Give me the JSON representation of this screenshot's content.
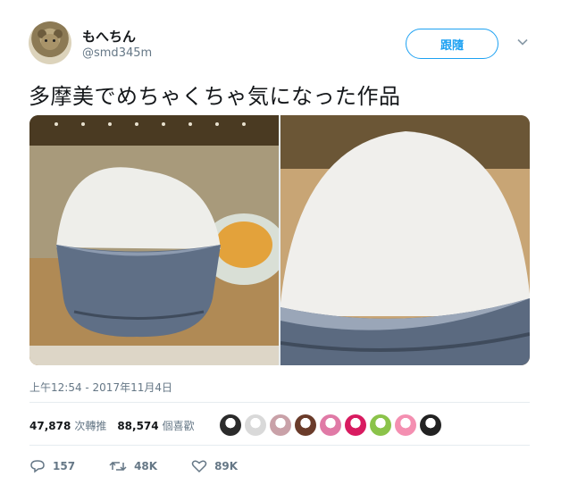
{
  "user": {
    "name": "もへちん",
    "handle": "@smd345m"
  },
  "follow_label": "跟隨",
  "tweet_text": "多摩美でめちゃくちゃ気になった作品",
  "timestamp": "上午12:54 - 2017年11月4日",
  "stats": {
    "retweets_count": "47,878",
    "retweets_label": "次轉推",
    "likes_count": "88,574",
    "likes_label": "個喜歡"
  },
  "likers": [
    "#2b2b2b",
    "#d9d9d9",
    "#c9a1a8",
    "#6a3b2a",
    "#e07aa6",
    "#d81b60",
    "#8bc34a",
    "#f48fb1",
    "#222222"
  ],
  "actions": {
    "replies": "157",
    "retweets": "48K",
    "likes": "89K"
  },
  "colors": {
    "accent": "#1da1f2",
    "muted": "#657786",
    "text": "#14171a"
  }
}
